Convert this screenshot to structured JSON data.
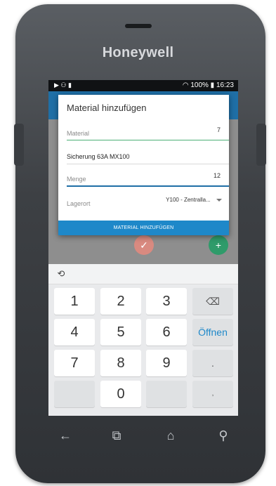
{
  "device": {
    "brand": "Honeywell"
  },
  "status_bar": {
    "left_icons": "▶ ⚇ ▮",
    "right_text": "100% ▮ 16:23",
    "signal_icons": "◠ ⃠"
  },
  "dialog": {
    "title": "Material hinzufügen",
    "material_label": "Material",
    "material_count": "7",
    "material_value": "Sicherung 63A MX100",
    "menge_label": "Menge",
    "menge_value": "12",
    "lagerort_label": "Lagerort",
    "lagerort_value": "Y100 - Zentralla...",
    "submit_label": "MATERIAL HINZUFÜGEN"
  },
  "fabs": {
    "check": "✓",
    "plus": "+"
  },
  "keyboard": {
    "rows": [
      [
        "1",
        "2",
        "3",
        "⌫"
      ],
      [
        "4",
        "5",
        "6",
        "Öffnen"
      ],
      [
        "7",
        "8",
        "9",
        "."
      ],
      [
        "",
        "0",
        "",
        ","
      ]
    ]
  },
  "nav": {
    "back": "←",
    "recent": "⧉",
    "home": "⌂",
    "search": "⚲"
  },
  "colors": {
    "accent": "#1e88c9",
    "green": "#2f9b6a",
    "appbar": "#1f6fa6"
  }
}
